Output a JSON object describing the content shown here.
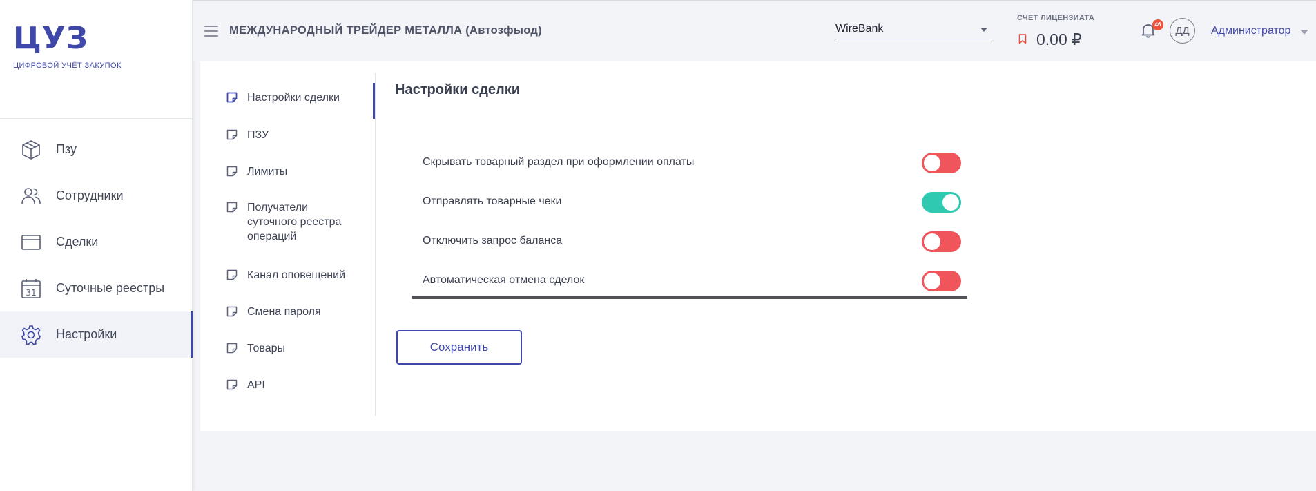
{
  "app": {
    "logo": "ЦУЗ",
    "logo_subtitle": "ЦИФРОВОЙ УЧЁТ ЗАКУПОК"
  },
  "sidebar": {
    "items": [
      {
        "label": "Пзу",
        "icon": "box-icon",
        "active": false
      },
      {
        "label": "Сотрудники",
        "icon": "users-icon",
        "active": false
      },
      {
        "label": "Сделки",
        "icon": "card-icon",
        "active": false
      },
      {
        "label": "Суточные реестры",
        "icon": "calendar-icon",
        "active": false,
        "icon_text": "31"
      },
      {
        "label": "Настройки",
        "icon": "gear-icon",
        "active": true
      }
    ]
  },
  "header": {
    "company": "МЕЖДУНАРОДНЫЙ ТРЕЙДЕР МЕТАЛЛА (Автозфыод)",
    "bank_select": "WireBank",
    "account_label": "СЧЕТ ЛИЦЕНЗИАТА",
    "account_value": "0.00 ₽",
    "notifications_badge": "46",
    "avatar_initials": "ДД",
    "role": "Администратор"
  },
  "subnav": {
    "items": [
      {
        "label": "Настройки сделки",
        "active": true
      },
      {
        "label": "ПЗУ",
        "active": false
      },
      {
        "label": "Лимиты",
        "active": false
      },
      {
        "label": "Получатели суточного реестра операций",
        "active": false
      },
      {
        "label": "Канал оповещений",
        "active": false
      },
      {
        "label": "Смена пароля",
        "active": false
      },
      {
        "label": "Товары",
        "active": false
      },
      {
        "label": "API",
        "active": false
      }
    ]
  },
  "content": {
    "title": "Настройки сделки",
    "settings": [
      {
        "label": "Скрывать товарный раздел при оформлении оплаты",
        "enabled": false
      },
      {
        "label": "Отправлять товарные чеки",
        "enabled": true
      },
      {
        "label": "Отключить запрос баланса",
        "enabled": false
      },
      {
        "label": "Автоматическая отмена сделок",
        "enabled": false
      }
    ],
    "save_label": "Сохранить"
  },
  "colors": {
    "accent": "#3f48a8",
    "toggle_on": "#2fc9b1",
    "toggle_off": "#f0555b",
    "badge": "#f0513b"
  }
}
